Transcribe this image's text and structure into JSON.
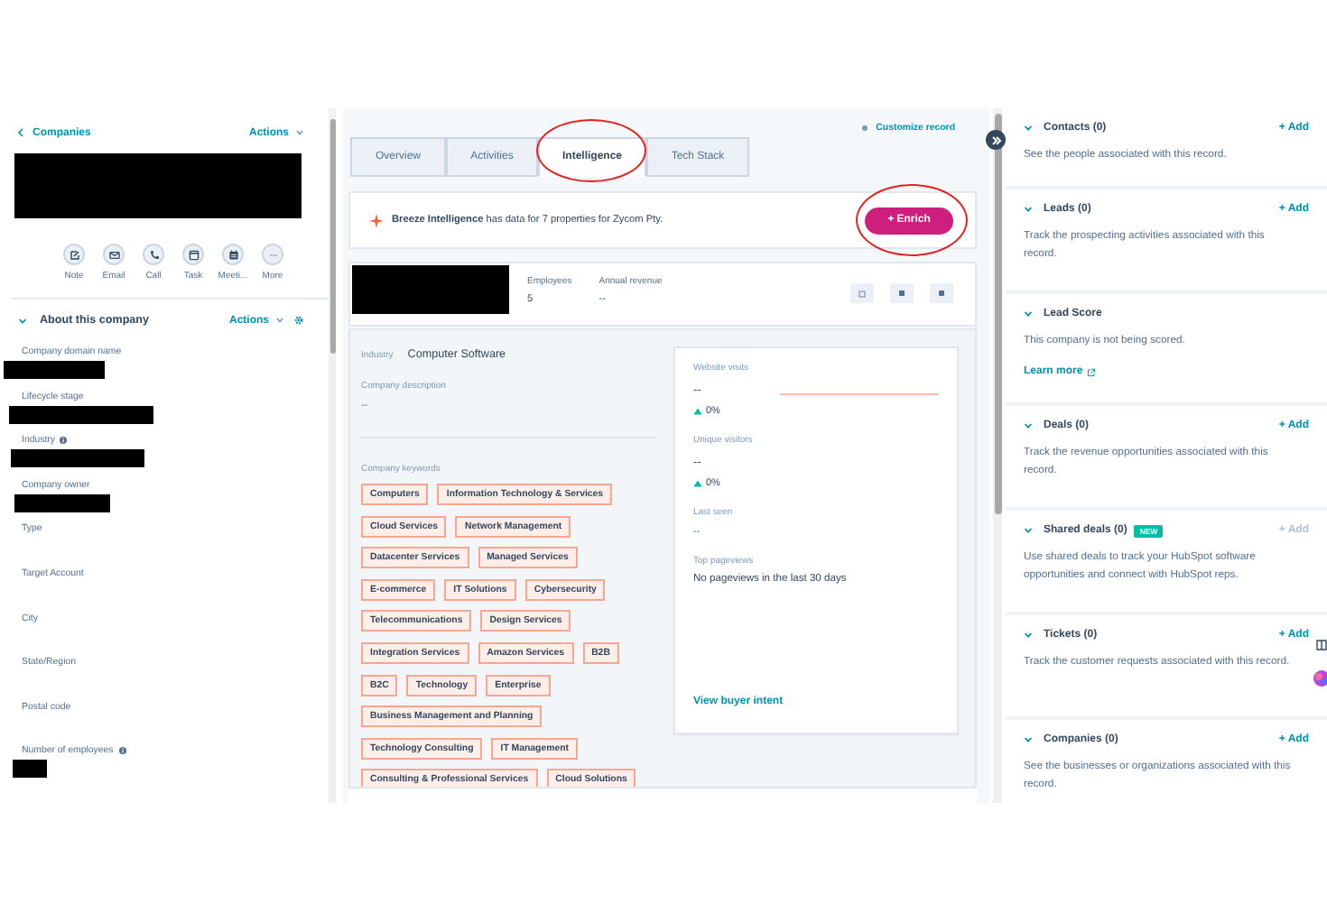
{
  "sidebar": {
    "back_label": "Companies",
    "actions_label": "Actions",
    "quick_actions": [
      {
        "label": "Note"
      },
      {
        "label": "Email"
      },
      {
        "label": "Call"
      },
      {
        "label": "Task"
      },
      {
        "label": "Meeti..."
      },
      {
        "label": "More"
      }
    ],
    "about_title": "About this company",
    "about_actions_label": "Actions",
    "properties": [
      {
        "label": "Company domain name",
        "info": false,
        "redacted": true
      },
      {
        "label": "Lifecycle stage",
        "info": false,
        "redacted": true
      },
      {
        "label": "Industry",
        "info": true,
        "redacted": true
      },
      {
        "label": "Company owner",
        "info": false,
        "redacted": true
      },
      {
        "label": "Type",
        "info": false,
        "redacted": false
      },
      {
        "label": "Target Account",
        "info": false,
        "redacted": false
      },
      {
        "label": "City",
        "info": false,
        "redacted": false
      },
      {
        "label": "State/Region",
        "info": false,
        "redacted": false
      },
      {
        "label": "Postal code",
        "info": false,
        "redacted": false
      },
      {
        "label": "Number of employees",
        "info": true,
        "redacted": true
      }
    ]
  },
  "customize_link": "Customize record",
  "tabs": [
    {
      "label": "Overview",
      "selected": false,
      "circled": false
    },
    {
      "label": "Activities",
      "selected": false,
      "circled": false
    },
    {
      "label": "Intelligence",
      "selected": true,
      "circled": true
    },
    {
      "label": "Tech Stack",
      "selected": false,
      "circled": false
    }
  ],
  "banner": {
    "text": "**Breeze Intelligence** has data for 7 properties for Zycom Pty.",
    "button": {
      "label": "+ Enrich",
      "circled": true
    }
  },
  "summary": {
    "stats": [
      {
        "label": "Employees",
        "value": "5"
      },
      {
        "label": "Annual revenue",
        "value": "--"
      }
    ]
  },
  "industry": {
    "label": "Industry",
    "value": "Computer Software"
  },
  "description": {
    "label": "Company description",
    "value": "--"
  },
  "keywords": {
    "label": "Company keywords",
    "tags": [
      "Computers",
      "Information Technology & Services",
      "Cloud Services",
      "Network Management",
      "Datacenter Services",
      "Managed Services",
      "E-commerce",
      "IT Solutions",
      "Cybersecurity",
      "Telecommunications",
      "Design Services",
      "Integration Services",
      "Amazon Services",
      "B2B",
      "B2C",
      "Technology",
      "Enterprise",
      "Business Management and Planning",
      "Technology Consulting",
      "IT Management",
      "Consulting & Professional Services",
      "Cloud Solutions"
    ]
  },
  "traffic": {
    "metrics": [
      {
        "label": "Website visits",
        "value": "--",
        "change": "0%"
      },
      {
        "label": "Unique visitors",
        "value": "--",
        "change": "0%"
      }
    ],
    "last_seen": {
      "label": "Last seen",
      "value": "--"
    },
    "top_pageviews": {
      "label": "Top pageviews",
      "value": "No pageviews in the last 30 days"
    },
    "link": "View buyer intent"
  },
  "associations": [
    {
      "title": "Contacts (0)",
      "add_label": "+ Add",
      "add_disabled": false,
      "description": "See the people associated with this record."
    },
    {
      "title": "Leads (0)",
      "add_label": "+ Add",
      "add_disabled": false,
      "description": "Track the prospecting activities associated with this record."
    },
    {
      "title": "Lead Score",
      "description": "This company is not being scored.",
      "link": "Learn more"
    },
    {
      "title": "Deals (0)",
      "add_label": "+ Add",
      "add_disabled": false,
      "description": "Track the revenue opportunities associated with this record."
    },
    {
      "title": "Shared deals (0)",
      "badge": "NEW",
      "add_label": "+ Add",
      "add_disabled": true,
      "description": "Use shared deals to track your HubSpot software opportunities and connect with HubSpot reps."
    },
    {
      "title": "Tickets (0)",
      "add_label": "+ Add",
      "add_disabled": false,
      "description": "Track the customer requests associated with this record."
    },
    {
      "title": "Companies (0)",
      "add_label": "+ Add",
      "add_disabled": false,
      "description": "See the businesses or organizations associated with this record."
    }
  ]
}
